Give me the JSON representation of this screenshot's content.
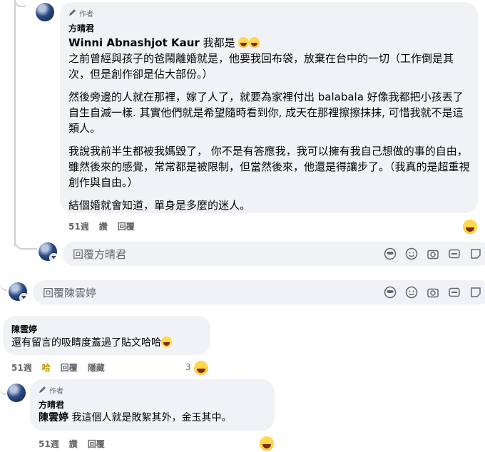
{
  "comment1": {
    "badge": "作者",
    "name": "方晴君",
    "mention": "Winni Abnashjot Kaur",
    "first_line_suffix": " 我都是",
    "paragraphs": [
      "之前曾經與孩子的爸鬧離婚就是，他要我回布袋，放棄在台中的一切（工作倒是其次，但是創作卻是佔大部份。）",
      "然後旁邊的人就在那裡，嫁了人了，就要為家裡付出 balabala 好像我都把小孩丟了自生自滅一樣. 其實他們就是希望隨時看到你, 成天在那裡擦擦抹抹, 可惜我就不是這類人。",
      "我說我前半生都被我媽毀了， 你不是有答應我，我可以擁有我自己想做的事的自由，雖然後來的感覺，常常都是被限制，但當然後來，他還是得讓步了。（我真的是超重視創作與自由。）",
      "結個婚就會知道，單身是多麼的迷人。"
    ],
    "time": "51週",
    "like": "讚",
    "reply": "回覆"
  },
  "reply_box_1": {
    "placeholder": "回覆方晴君"
  },
  "reply_box_2": {
    "placeholder": "回覆陳雲婷"
  },
  "comment2": {
    "name": "陳雲婷",
    "text": "還有留言的吸睛度蓋過了貼文哈哈",
    "time": "51週",
    "like": "哈",
    "reply": "回覆",
    "hide": "隱藏",
    "reaction_count": "3"
  },
  "comment3": {
    "badge": "作者",
    "name": "方晴君",
    "mention": "陳雲婷",
    "text": " 我這個人就是敗絮其外，金玉其中。",
    "time": "51週",
    "like": "讚",
    "reply": "回覆"
  }
}
